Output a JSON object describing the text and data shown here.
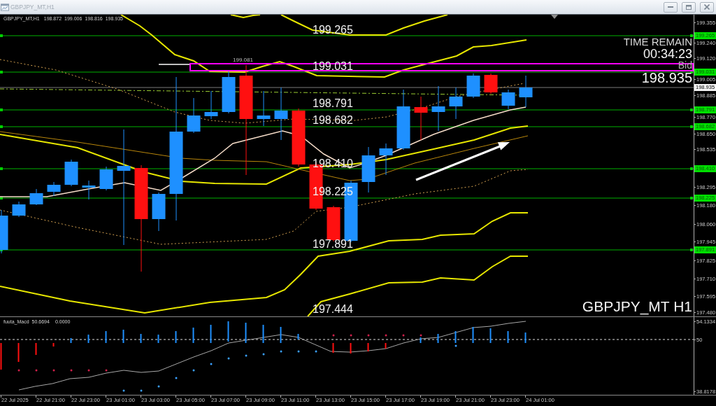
{
  "window": {
    "title": "GBPJPY_MT,H1"
  },
  "chart": {
    "header": {
      "symbol": "GBPJPY_MT,H1",
      "ohlc": [
        "198.872",
        "199.006",
        "198.816",
        "198.935"
      ]
    },
    "high_label": "199.081",
    "levels": [
      {
        "label": "199.265",
        "axis_label": "199.265"
      },
      {
        "label": "199.031",
        "axis_label": "199.031"
      },
      {
        "label": "198.791",
        "axis_label": "198.791"
      },
      {
        "label": "198.682",
        "axis_label": "198.682"
      },
      {
        "label": "198.410",
        "axis_label": "198.410"
      },
      {
        "label": "198.225",
        "axis_label": "198.225"
      },
      {
        "label": "197.891",
        "axis_label": "197.891"
      }
    ],
    "bottom_label": "197.444",
    "timer": {
      "title": "TIME REMAIN",
      "remaining": "00:34:23",
      "price_type": "Bid",
      "price": "198.935"
    },
    "symbol_caption": "GBPJPY_MT H1",
    "price_axis": {
      "ticks": [
        "199.355",
        "199.240",
        "199.120",
        "199.005",
        "198.885",
        "198.770",
        "198.650",
        "198.535",
        "198.295",
        "198.180",
        "198.060",
        "197.945",
        "197.825",
        "197.710",
        "197.595",
        "197.480"
      ],
      "bid_label": "198.935"
    }
  },
  "indicator": {
    "name": "fuuta_Macd",
    "values": [
      "50.6694",
      "0.0000"
    ],
    "axis": [
      "54.1334",
      "50",
      "38.8178"
    ]
  },
  "time_axis": [
    "22 Jul 2025",
    "22 Jul 21:00",
    "22 Jul 23:00",
    "23 Jul 01:00",
    "23 Jul 03:00",
    "23 Jul 05:00",
    "23 Jul 07:00",
    "23 Jul 09:00",
    "23 Jul 11:00",
    "23 Jul 13:00",
    "23 Jul 15:00",
    "23 Jul 17:00",
    "23 Jul 19:00",
    "23 Jul 21:00",
    "23 Jul 23:00",
    "24 Jul 01:00"
  ]
}
